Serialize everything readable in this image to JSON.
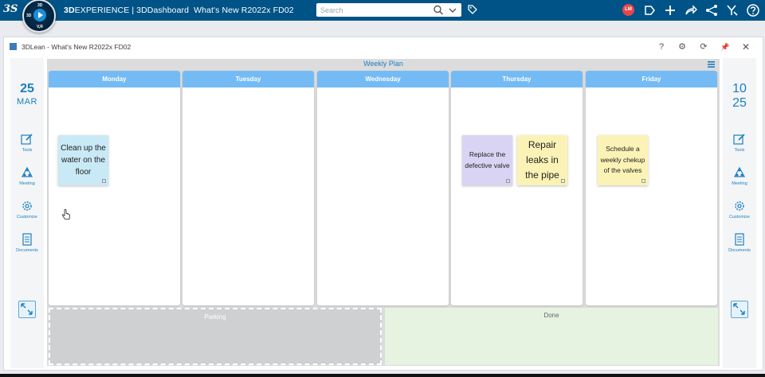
{
  "topbar": {
    "logo": "3S",
    "compass": {
      "top": "3D",
      "left": "3D",
      "bottom": "V,R"
    },
    "brand_strong": "3D",
    "brand_rest": "EXPERIENCE | 3DDashboard",
    "dashboard_name": "What's New R2022x FD02",
    "search_placeholder": "Search",
    "avatar_initials": "LM"
  },
  "app": {
    "title": "3DLean - What's New R2022x FD02",
    "header_buttons": [
      "?",
      "⚙",
      "⟳",
      "📌",
      "✕"
    ]
  },
  "left_sidebar": {
    "day": "25",
    "month": "MAR",
    "tools": [
      {
        "label": "Tools",
        "icon": "edit-icon"
      },
      {
        "label": "Meeting",
        "icon": "meeting-icon"
      },
      {
        "label": "Customize",
        "icon": "gear-icon"
      },
      {
        "label": "Documents",
        "icon": "document-icon"
      }
    ]
  },
  "right_sidebar": {
    "line1": "10",
    "line2": "25",
    "tools": [
      {
        "label": "Tools",
        "icon": "edit-icon"
      },
      {
        "label": "Meeting",
        "icon": "meeting-icon"
      },
      {
        "label": "Customize",
        "icon": "gear-icon"
      },
      {
        "label": "Documents",
        "icon": "document-icon"
      }
    ]
  },
  "board": {
    "title": "Weekly Plan",
    "columns": [
      {
        "label": "Monday"
      },
      {
        "label": "Tuesday"
      },
      {
        "label": "Wednesday"
      },
      {
        "label": "Thursday"
      },
      {
        "label": "Friday"
      }
    ],
    "notes": [
      {
        "text": "Clean up the water on the floor",
        "color": "#c9e9f6"
      },
      {
        "text": "Replace the defective valve",
        "color": "#d9d4f3"
      },
      {
        "text": "Repair leaks in the pipe",
        "color": "#fbf3b6"
      },
      {
        "text": "Schedule a weekly chekup of the valves",
        "color": "#fbf3b6"
      }
    ],
    "lanes": {
      "parking": "Parking",
      "done": "Done"
    }
  },
  "colors": {
    "topbar": "#005386",
    "column_header": "#74bbf5",
    "accent": "#1a7fc1"
  }
}
